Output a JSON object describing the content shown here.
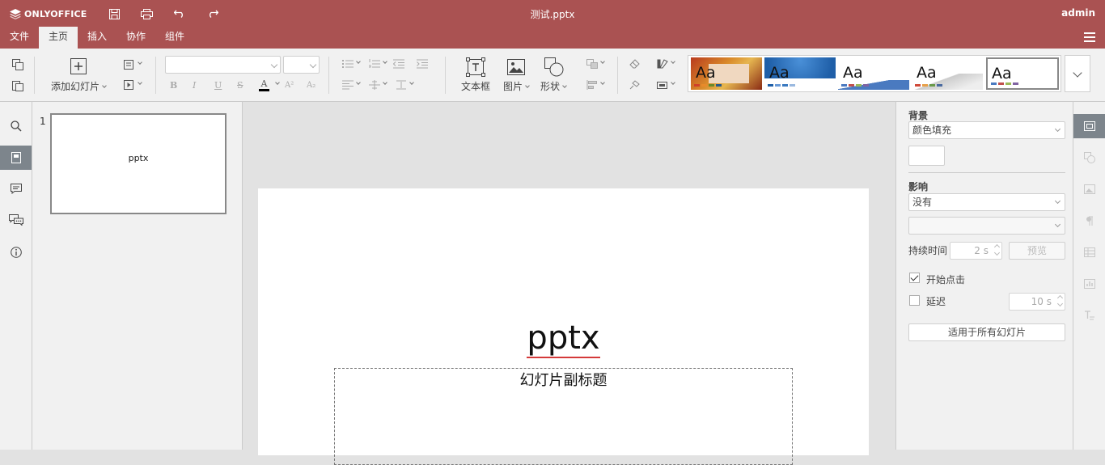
{
  "app": {
    "logo_text": "ONLYOFFICE",
    "doc_title": "测试.pptx",
    "user": "admin"
  },
  "tabs": [
    {
      "label": "文件"
    },
    {
      "label": "主页"
    },
    {
      "label": "插入"
    },
    {
      "label": "协作"
    },
    {
      "label": "组件"
    }
  ],
  "toolbar": {
    "add_slide": "添加幻灯片",
    "textbox": "文本框",
    "image": "图片",
    "shape": "形状",
    "fmt_bold": "B",
    "fmt_italic": "I",
    "fmt_underline": "U",
    "fmt_strike": "S",
    "fmt_color": "A",
    "fmt_sup": "A²",
    "fmt_sub": "A₂",
    "theme_aa": "Aa"
  },
  "slides_panel": {
    "number": "1",
    "thumb_title": "pptx"
  },
  "slide": {
    "title": "pptx",
    "subtitle": "幻灯片副标题"
  },
  "settings": {
    "background_label": "背景",
    "fill_value": "颜色填充",
    "effect_label": "影响",
    "effect_value": "没有",
    "duration_label": "持续时间",
    "duration_value": "2 s",
    "preview": "预览",
    "start_on_click": "开始点击",
    "start_on_click_checked": true,
    "delay": "延迟",
    "delay_checked": false,
    "delay_value": "10 s",
    "apply_all": "适用于所有幻灯片"
  },
  "colors": {
    "header": "#aa5252",
    "active_rail": "#7d858c"
  }
}
